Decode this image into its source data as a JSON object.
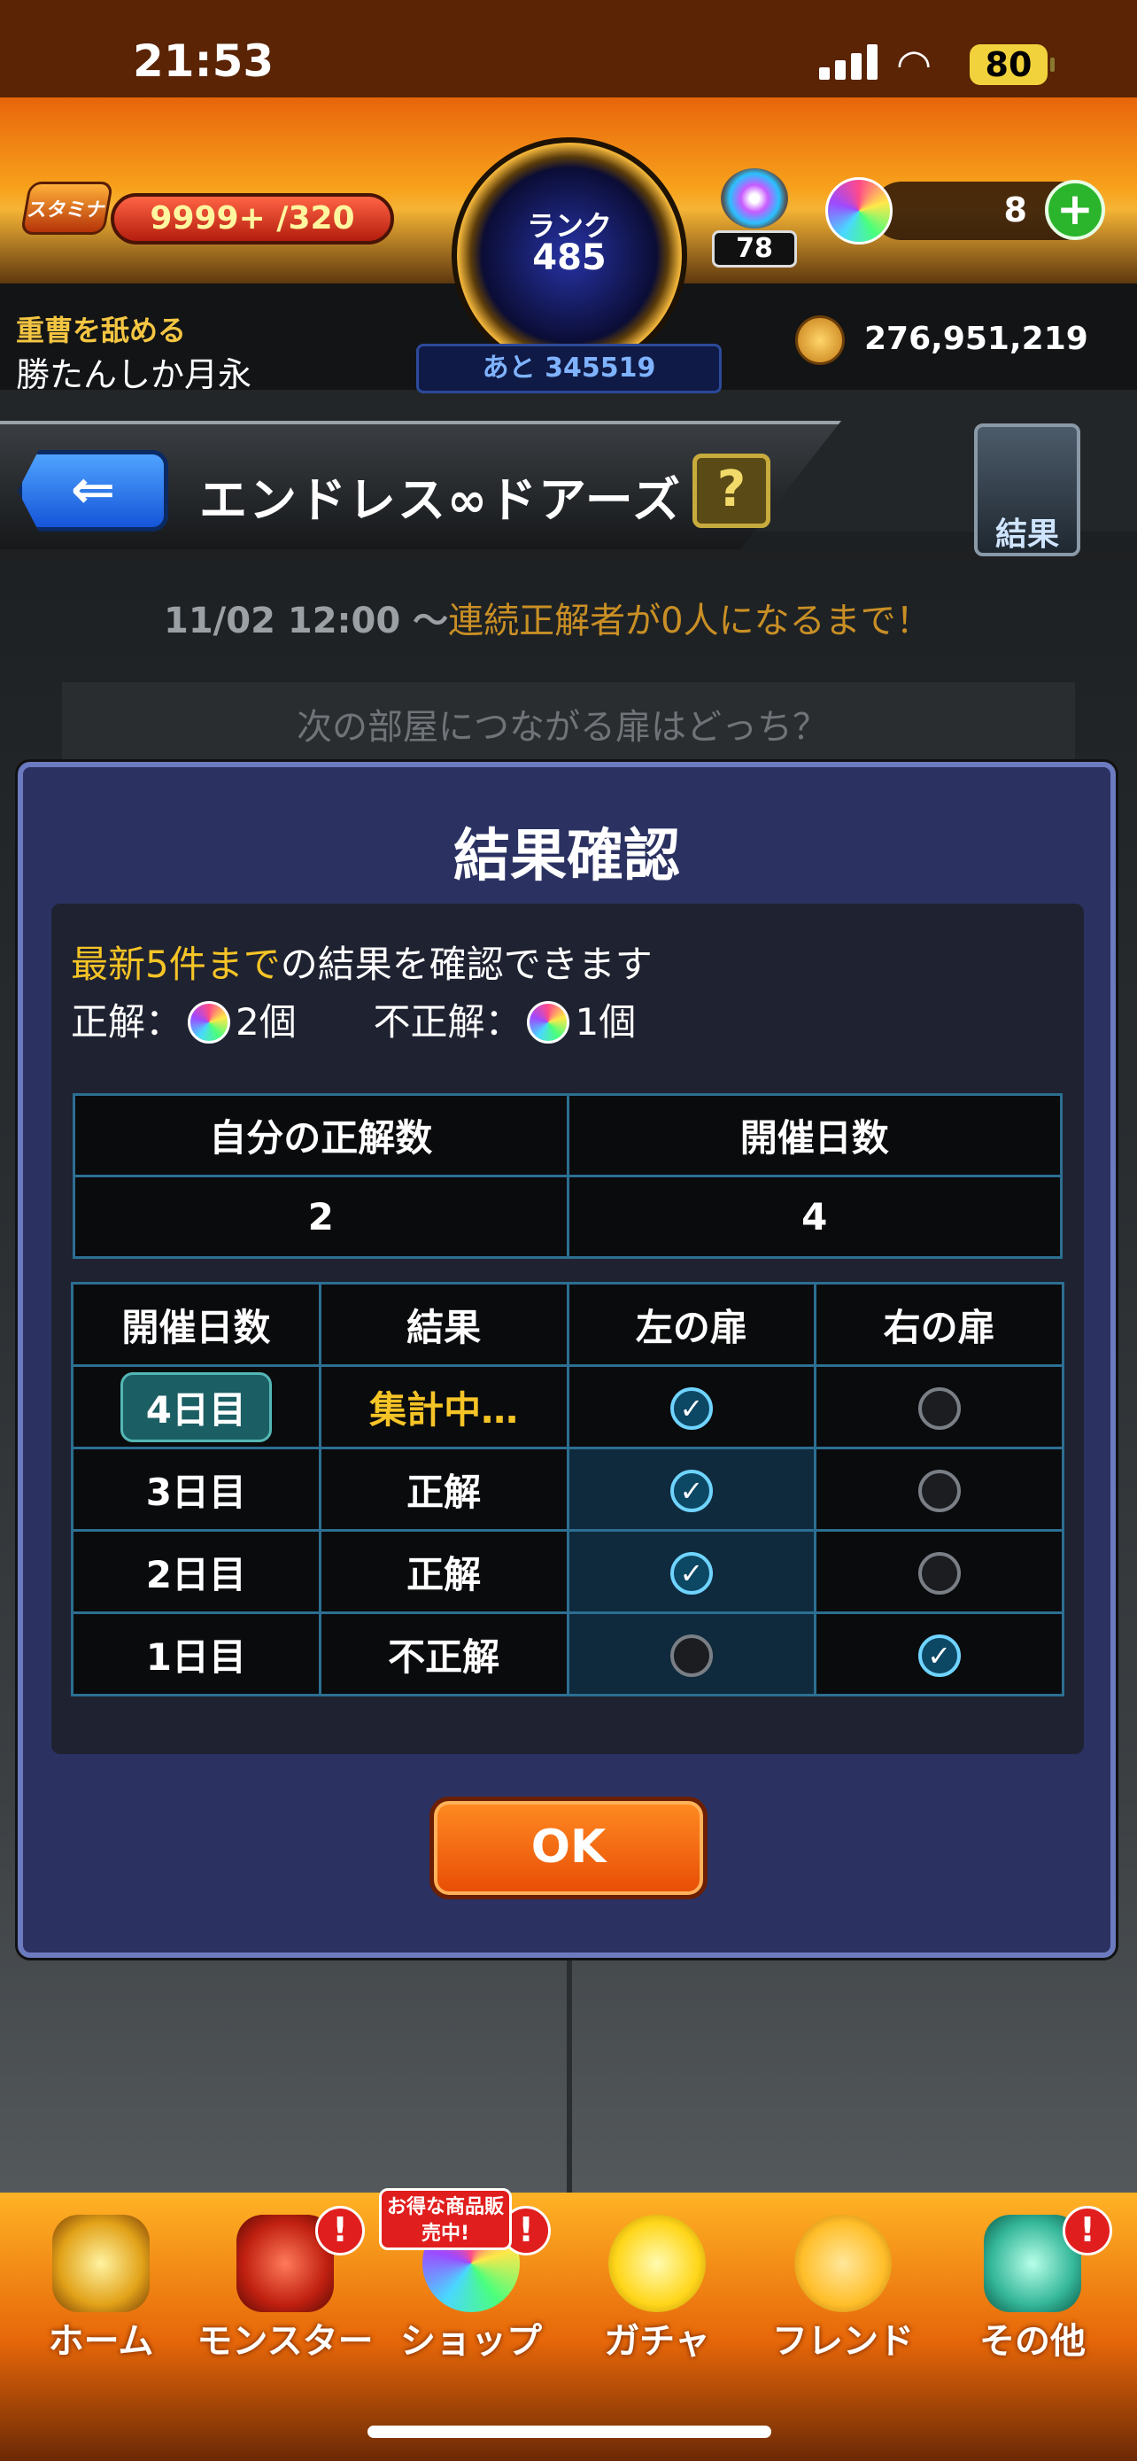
{
  "status_bar": {
    "time": "21:53",
    "battery": "80"
  },
  "header": {
    "stamina_label": "スタミナ",
    "stamina_value": "9999+ /320",
    "rank_label": "ランク",
    "rank_value": "485",
    "rank_next": "あと 345519",
    "box_count": "78",
    "orb_count": "8",
    "player_title": "重曹を舐める",
    "player_name": "勝たんしか月永",
    "coins": "276,951,219"
  },
  "title_bar": {
    "back_icon": "back-arrow-icon",
    "title": "エンドレス∞ドアーズ",
    "help": "?",
    "result_label": "結果"
  },
  "event": {
    "start": "11/02 12:00 ～",
    "until": "連続正解者が0人になるまで！",
    "question": "次の部屋につながる扉はどっち？"
  },
  "modal": {
    "title": "結果確認",
    "info_highlight": "最新5件まで",
    "info_rest": "の結果を確認できます",
    "correct_label": "正解：",
    "correct_value": "2個",
    "incorrect_label": "不正解：",
    "incorrect_value": "1個",
    "summary": {
      "headers": [
        "自分の正解数",
        "開催日数"
      ],
      "values": [
        "2",
        "4"
      ]
    },
    "history": {
      "headers": [
        "開催日数",
        "結果",
        "左の扉",
        "右の扉"
      ],
      "rows": [
        {
          "day": "4日目",
          "result": "集計中…",
          "left": true,
          "right": false
        },
        {
          "day": "3日目",
          "result": "正解",
          "left": true,
          "right": false
        },
        {
          "day": "2日目",
          "result": "正解",
          "left": true,
          "right": false
        },
        {
          "day": "1日目",
          "result": "不正解",
          "left": false,
          "right": true
        }
      ]
    },
    "ok": "OK"
  },
  "nav": {
    "items": [
      {
        "label": "ホーム",
        "badge": ""
      },
      {
        "label": "モンスター",
        "badge": "!"
      },
      {
        "label": "ショップ",
        "badge": "!"
      },
      {
        "label": "ガチャ",
        "badge": ""
      },
      {
        "label": "フレンド",
        "badge": ""
      },
      {
        "label": "その他",
        "badge": "!"
      }
    ],
    "sale_banner": "お得な商品販売中!"
  }
}
